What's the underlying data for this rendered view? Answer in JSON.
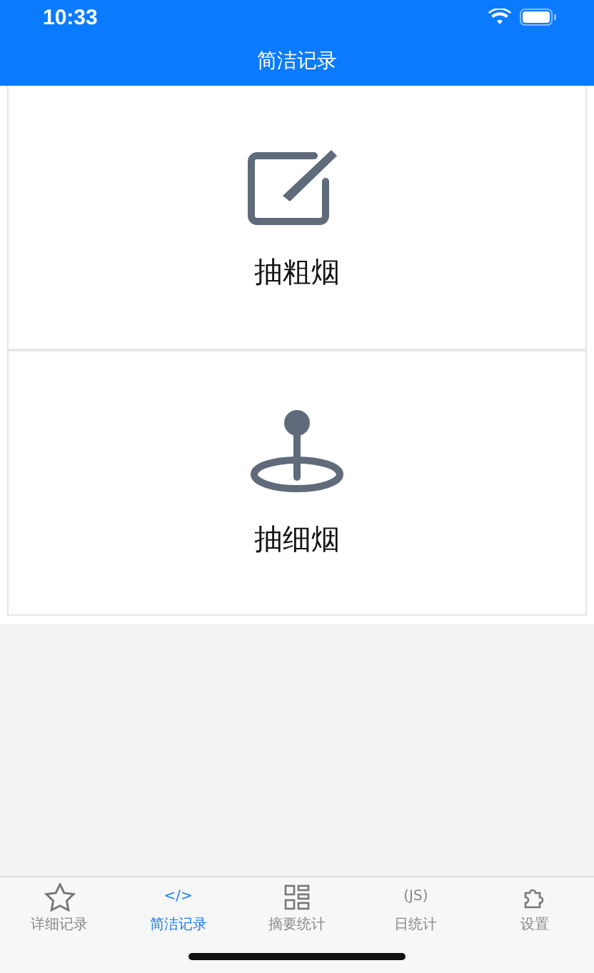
{
  "status_bar": {
    "time": "10:33"
  },
  "nav": {
    "title": "简洁记录"
  },
  "actions": [
    {
      "kind": "edit",
      "label": "抽粗烟"
    },
    {
      "kind": "pin",
      "label": "抽细烟"
    }
  ],
  "tab_bar": [
    {
      "kind": "star",
      "label": "详细记录",
      "selected": false
    },
    {
      "kind": "glyph",
      "glyph": "</>",
      "label": "简洁记录",
      "selected": true
    },
    {
      "kind": "grid",
      "label": "摘要统计",
      "selected": false
    },
    {
      "kind": "glyph",
      "glyph": "(JS)",
      "label": "日统计",
      "selected": false
    },
    {
      "kind": "puzzle",
      "label": "设置",
      "selected": false
    }
  ]
}
